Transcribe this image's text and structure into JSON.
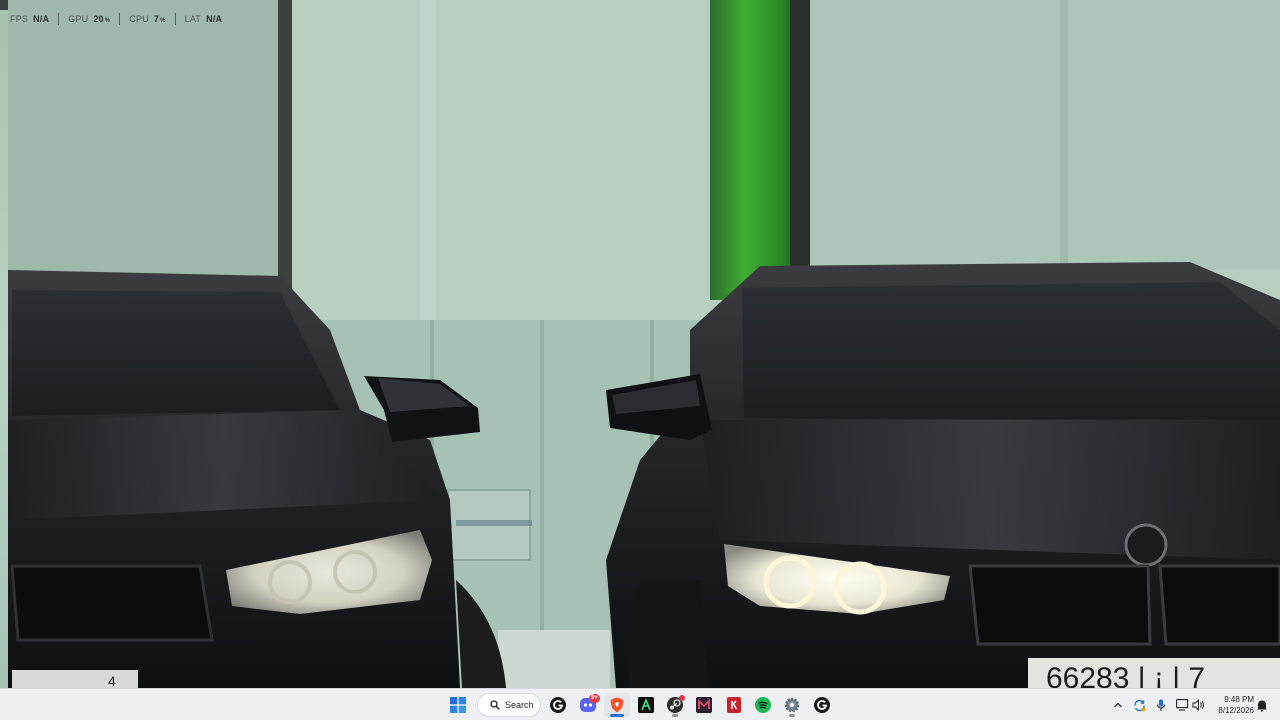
{
  "perf_overlay": {
    "metrics": [
      {
        "label": "FPS",
        "value": "N/A",
        "unit": ""
      },
      {
        "label": "GPU",
        "value": "20",
        "unit": "%"
      },
      {
        "label": "CPU",
        "value": "7",
        "unit": "%"
      },
      {
        "label": "LAT",
        "value": "N/A",
        "unit": ""
      }
    ]
  },
  "wallpaper": {
    "license_plate_right": "66283 | ¡ | 7",
    "license_plate_left": "4"
  },
  "taskbar": {
    "search_label": "Search",
    "notification_badge": "9+",
    "pinned": [
      {
        "name": "start",
        "icon": "windows-start-icon"
      },
      {
        "name": "app-g",
        "icon": "g-app-icon"
      },
      {
        "name": "discord",
        "icon": "discord-icon"
      },
      {
        "name": "brave",
        "icon": "brave-icon"
      },
      {
        "name": "app-a",
        "icon": "a-app-icon"
      },
      {
        "name": "steam",
        "icon": "steam-icon"
      },
      {
        "name": "app-m",
        "icon": "m-app-icon"
      },
      {
        "name": "app-red",
        "icon": "red-app-icon"
      },
      {
        "name": "spotify",
        "icon": "spotify-icon"
      },
      {
        "name": "settings",
        "icon": "settings-gear-icon"
      },
      {
        "name": "app-g2",
        "icon": "g-app-icon"
      }
    ],
    "tray_icons": [
      "chevron-up-icon",
      "sync-icon",
      "microphone-icon",
      "display-icon",
      "volume-icon"
    ],
    "time": "9:48 PM",
    "date": "8/12/2026",
    "colors": {
      "accent": "#2b6fd6",
      "taskbar_bg": "#eef0f3",
      "brave": "#fb542b",
      "spotify": "#1db954"
    }
  }
}
